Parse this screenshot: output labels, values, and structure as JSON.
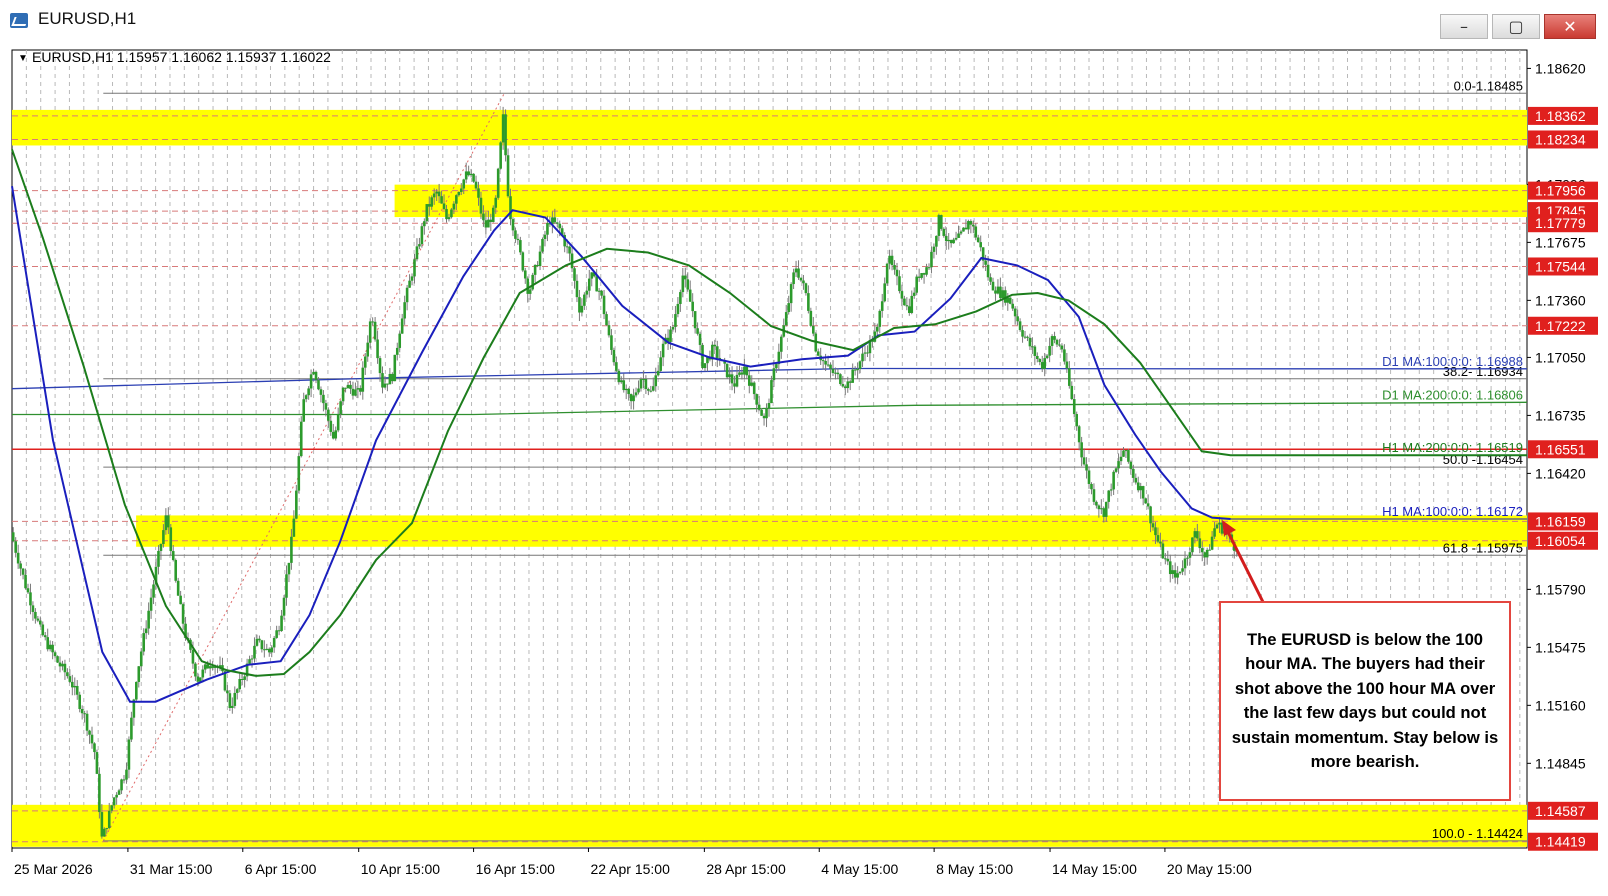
{
  "window": {
    "title": "EURUSD,H1",
    "controls": {
      "minimize": "–",
      "maximize": "▢",
      "close": "✕"
    }
  },
  "header": {
    "info": "EURUSD,H1  1.15957 1.16062 1.15937 1.16022"
  },
  "colors": {
    "zone": "#ffff00",
    "ma100": "#1a1fbd",
    "ma200": "#1c7d1c",
    "d1_ma100": "#2b3fb3",
    "d1_ma200": "#2f8f2f",
    "support_line": "#e0201e",
    "price_tag": "#e0201e",
    "candle": "#2c9a2c",
    "wick": "#7a7a7a",
    "fib": "#777777"
  },
  "annotation": {
    "text": "The EURUSD is below the 100 hour MA. The buyers had their shot above the 100 hour MA over the last few days but could not sustain momentum. Stay below is more bearish."
  },
  "chart_data": {
    "type": "candlestick",
    "symbol": "EURUSD",
    "timeframe": "H1",
    "ohlc_last": {
      "open": 1.15957,
      "high": 1.16062,
      "low": 1.15937,
      "close": 1.16022
    },
    "ylim": [
      1.14385,
      1.1872
    ],
    "xlim": [
      0,
      1477
    ],
    "y_tick_labels": [
      "1.18620",
      "1.17990",
      "1.17675",
      "1.17360",
      "1.17050",
      "1.16735",
      "1.16420",
      "1.15790",
      "1.15475",
      "1.15160",
      "1.14845"
    ],
    "x_tick_labels": [
      {
        "t": 0,
        "label": "25 Mar 2026"
      },
      {
        "t": 113,
        "label": "31 Mar 15:00"
      },
      {
        "t": 225,
        "label": "6 Apr 15:00"
      },
      {
        "t": 338,
        "label": "10 Apr 15:00"
      },
      {
        "t": 450,
        "label": "16 Apr 15:00"
      },
      {
        "t": 562,
        "label": "22 Apr 15:00"
      },
      {
        "t": 675,
        "label": "28 Apr 15:00"
      },
      {
        "t": 787,
        "label": "4 May 15:00"
      },
      {
        "t": 899,
        "label": "8 May 15:00"
      },
      {
        "t": 1012,
        "label": "14 May 15:00"
      },
      {
        "t": 1124,
        "label": "20 May 15:00"
      }
    ],
    "zones": [
      {
        "from": 1.18234,
        "to": 1.18362,
        "start": 0
      },
      {
        "from": 1.17845,
        "to": 1.17956,
        "start": 373
      },
      {
        "from": 1.16054,
        "to": 1.16159,
        "start": 121
      },
      {
        "from": 1.14424,
        "to": 1.14587,
        "start": 0
      }
    ],
    "price_tags": [
      "1.18362",
      "1.18234",
      "1.17956",
      "1.17845",
      "1.17779",
      "1.17544",
      "1.17222",
      "1.16551",
      "1.16159",
      "1.16054",
      "1.14587",
      "1.14419"
    ],
    "dashed_levels": [
      "1.18362",
      "1.18234",
      "1.17956",
      "1.17845",
      "1.17779",
      "1.17544",
      "1.17222",
      "1.16159",
      "1.16054",
      "1.14587",
      "1.14419"
    ],
    "horizontal_line": {
      "value": "1.16551",
      "label": "1.16551"
    },
    "fibonacci": {
      "swing_from": {
        "t": 89,
        "price": 1.14424
      },
      "swing_to": {
        "t": 480,
        "price": 1.18485
      },
      "line_start": 89,
      "levels": [
        {
          "label": "0.0-1.18485",
          "value": 1.18485
        },
        {
          "label": "38.2- 1.16934",
          "value": 1.16934
        },
        {
          "label": "50.0 -1.16454",
          "value": 1.16454
        },
        {
          "label": "61.8 -1.15975",
          "value": 1.15975
        },
        {
          "label": "100.0 - 1.14424",
          "value": 1.14424
        }
      ]
    },
    "ma_labels": [
      {
        "label": "D1 MA:100:0:0: 1.16988",
        "value": 1.16988,
        "color_key": "d1_ma100"
      },
      {
        "label": "D1 MA:200:0:0: 1.16806",
        "value": 1.16806,
        "color_key": "d1_ma200"
      },
      {
        "label": "H1 MA:200:0:0: 1.16519",
        "value": 1.16519,
        "color_key": "ma200"
      },
      {
        "label": "H1 MA:100:0:0: 1.16172",
        "value": 1.16172,
        "color_key": "ma100"
      }
    ],
    "d1_ma100": {
      "from": [
        0,
        1.1688
      ],
      "to": [
        1477,
        1.16988
      ],
      "knots": [
        [
          0,
          1.1688
        ],
        [
          370,
          1.1694
        ],
        [
          820,
          1.1699
        ],
        [
          1180,
          1.16988
        ],
        [
          1477,
          1.16988
        ]
      ]
    },
    "d1_ma200": {
      "from": [
        0,
        1.1673
      ],
      "to": [
        1477,
        1.16806
      ],
      "knots": [
        [
          0,
          1.1674
        ],
        [
          450,
          1.1674
        ],
        [
          880,
          1.1679
        ],
        [
          1477,
          1.16806
        ]
      ]
    },
    "h1_ma100": [
      [
        0,
        1.1798
      ],
      [
        40,
        1.166
      ],
      [
        88,
        1.1545
      ],
      [
        115,
        1.1518
      ],
      [
        140,
        1.1518
      ],
      [
        190,
        1.153
      ],
      [
        230,
        1.1538
      ],
      [
        262,
        1.154
      ],
      [
        290,
        1.1565
      ],
      [
        320,
        1.1605
      ],
      [
        355,
        1.166
      ],
      [
        400,
        1.1708
      ],
      [
        440,
        1.1749
      ],
      [
        470,
        1.1774
      ],
      [
        488,
        1.1785
      ],
      [
        520,
        1.1781
      ],
      [
        555,
        1.176
      ],
      [
        595,
        1.1733
      ],
      [
        640,
        1.1713
      ],
      [
        680,
        1.1705
      ],
      [
        720,
        1.17
      ],
      [
        770,
        1.1704
      ],
      [
        815,
        1.1706
      ],
      [
        845,
        1.1717
      ],
      [
        880,
        1.1719
      ],
      [
        915,
        1.1737
      ],
      [
        945,
        1.1759
      ],
      [
        980,
        1.1755
      ],
      [
        1010,
        1.1747
      ],
      [
        1040,
        1.1727
      ],
      [
        1065,
        1.169
      ],
      [
        1095,
        1.1663
      ],
      [
        1120,
        1.1643
      ],
      [
        1150,
        1.1623
      ],
      [
        1170,
        1.1618
      ],
      [
        1188,
        1.16172
      ]
    ],
    "h1_ma200": [
      [
        0,
        1.1818
      ],
      [
        30,
        1.177
      ],
      [
        70,
        1.17
      ],
      [
        110,
        1.1625
      ],
      [
        150,
        1.157
      ],
      [
        185,
        1.154
      ],
      [
        210,
        1.1535
      ],
      [
        238,
        1.1532
      ],
      [
        265,
        1.1533
      ],
      [
        290,
        1.1545
      ],
      [
        320,
        1.1565
      ],
      [
        355,
        1.1595
      ],
      [
        390,
        1.1615
      ],
      [
        425,
        1.1665
      ],
      [
        460,
        1.1705
      ],
      [
        495,
        1.174
      ],
      [
        540,
        1.1755
      ],
      [
        580,
        1.1764
      ],
      [
        620,
        1.1762
      ],
      [
        660,
        1.1755
      ],
      [
        700,
        1.174
      ],
      [
        740,
        1.1722
      ],
      [
        780,
        1.1714
      ],
      [
        820,
        1.1709
      ],
      [
        860,
        1.1721
      ],
      [
        900,
        1.1723
      ],
      [
        940,
        1.173
      ],
      [
        975,
        1.1739
      ],
      [
        1000,
        1.174
      ],
      [
        1030,
        1.1736
      ],
      [
        1065,
        1.1723
      ],
      [
        1100,
        1.1702
      ],
      [
        1130,
        1.1678
      ],
      [
        1160,
        1.1654
      ],
      [
        1188,
        1.16519
      ],
      [
        1477,
        1.16519
      ]
    ],
    "price_path": [
      [
        0,
        1.161
      ],
      [
        15,
        1.158
      ],
      [
        30,
        1.1555
      ],
      [
        45,
        1.154
      ],
      [
        58,
        1.153
      ],
      [
        72,
        1.151
      ],
      [
        82,
        1.149
      ],
      [
        89,
        1.14424
      ],
      [
        100,
        1.1465
      ],
      [
        112,
        1.148
      ],
      [
        122,
        1.153
      ],
      [
        132,
        1.156
      ],
      [
        145,
        1.16
      ],
      [
        152,
        1.162
      ],
      [
        160,
        1.1585
      ],
      [
        170,
        1.1555
      ],
      [
        182,
        1.153
      ],
      [
        195,
        1.154
      ],
      [
        205,
        1.1535
      ],
      [
        214,
        1.1515
      ],
      [
        225,
        1.153
      ],
      [
        240,
        1.155
      ],
      [
        252,
        1.1545
      ],
      [
        262,
        1.156
      ],
      [
        275,
        1.161
      ],
      [
        285,
        1.168
      ],
      [
        295,
        1.17
      ],
      [
        305,
        1.168
      ],
      [
        315,
        1.166
      ],
      [
        325,
        1.169
      ],
      [
        340,
        1.1685
      ],
      [
        352,
        1.173
      ],
      [
        362,
        1.169
      ],
      [
        372,
        1.1695
      ],
      [
        382,
        1.173
      ],
      [
        395,
        1.176
      ],
      [
        405,
        1.1785
      ],
      [
        415,
        1.1795
      ],
      [
        425,
        1.178
      ],
      [
        435,
        1.1795
      ],
      [
        445,
        1.1805
      ],
      [
        452,
        1.18
      ],
      [
        462,
        1.1775
      ],
      [
        472,
        1.1785
      ],
      [
        480,
        1.1835
      ],
      [
        486,
        1.1785
      ],
      [
        495,
        1.1765
      ],
      [
        505,
        1.174
      ],
      [
        515,
        1.176
      ],
      [
        525,
        1.178
      ],
      [
        535,
        1.1775
      ],
      [
        545,
        1.176
      ],
      [
        555,
        1.173
      ],
      [
        565,
        1.175
      ],
      [
        575,
        1.174
      ],
      [
        585,
        1.171
      ],
      [
        595,
        1.169
      ],
      [
        605,
        1.168
      ],
      [
        615,
        1.1695
      ],
      [
        625,
        1.1685
      ],
      [
        635,
        1.171
      ],
      [
        645,
        1.172
      ],
      [
        655,
        1.175
      ],
      [
        665,
        1.173
      ],
      [
        675,
        1.17
      ],
      [
        685,
        1.171
      ],
      [
        695,
        1.17
      ],
      [
        705,
        1.169
      ],
      [
        715,
        1.17
      ],
      [
        725,
        1.1685
      ],
      [
        735,
        1.167
      ],
      [
        745,
        1.17
      ],
      [
        755,
        1.1725
      ],
      [
        765,
        1.1755
      ],
      [
        775,
        1.174
      ],
      [
        785,
        1.171
      ],
      [
        795,
        1.17
      ],
      [
        805,
        1.1695
      ],
      [
        815,
        1.169
      ],
      [
        825,
        1.17
      ],
      [
        835,
        1.171
      ],
      [
        845,
        1.172
      ],
      [
        855,
        1.176
      ],
      [
        865,
        1.1745
      ],
      [
        875,
        1.173
      ],
      [
        885,
        1.175
      ],
      [
        895,
        1.1755
      ],
      [
        905,
        1.178
      ],
      [
        915,
        1.1765
      ],
      [
        925,
        1.177
      ],
      [
        935,
        1.178
      ],
      [
        945,
        1.1765
      ],
      [
        955,
        1.1745
      ],
      [
        965,
        1.174
      ],
      [
        975,
        1.1735
      ],
      [
        985,
        1.172
      ],
      [
        995,
        1.171
      ],
      [
        1005,
        1.17
      ],
      [
        1015,
        1.1715
      ],
      [
        1025,
        1.171
      ],
      [
        1035,
        1.168
      ],
      [
        1045,
        1.165
      ],
      [
        1055,
        1.163
      ],
      [
        1065,
        1.162
      ],
      [
        1075,
        1.164
      ],
      [
        1085,
        1.1655
      ],
      [
        1095,
        1.164
      ],
      [
        1105,
        1.163
      ],
      [
        1115,
        1.161
      ],
      [
        1125,
        1.1595
      ],
      [
        1135,
        1.1585
      ],
      [
        1145,
        1.1595
      ],
      [
        1155,
        1.161
      ],
      [
        1165,
        1.1595
      ],
      [
        1175,
        1.1615
      ],
      [
        1185,
        1.161
      ],
      [
        1193,
        1.16022
      ]
    ]
  }
}
